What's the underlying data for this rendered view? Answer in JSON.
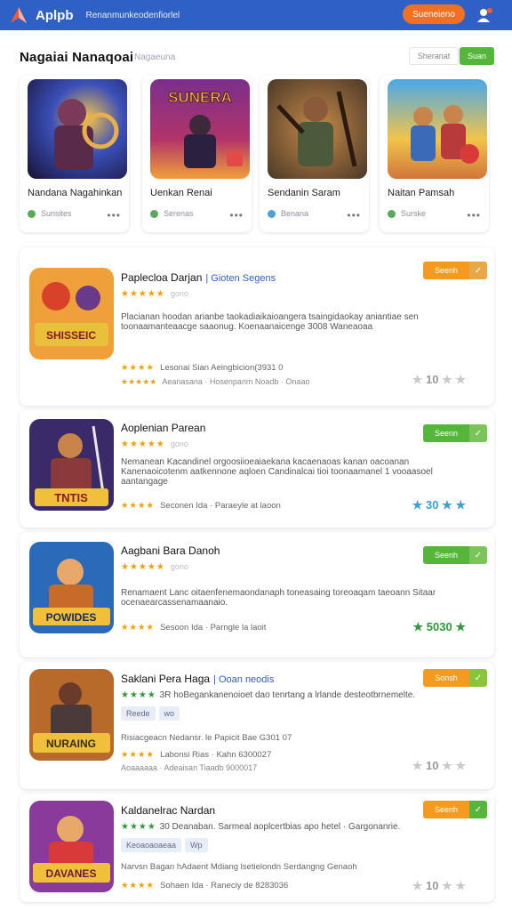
{
  "app": {
    "brand": "Aplpb",
    "tagline": "Renanmunkeodenfiorlel",
    "top_button": "Sueneieno"
  },
  "section": {
    "title": "Nagaiai Nanaqoai",
    "subtitle": "Nagaeuna",
    "search_placeholder": "Sheranat",
    "button": "Suan"
  },
  "featured": [
    {
      "name": "Nandana Nagahinkan",
      "status": "Sunsites",
      "art_text": "",
      "dot_color": "#5aa85a"
    },
    {
      "name": "Uenkan Renai",
      "status": "Serenas",
      "art_text": "SUNERA",
      "dot_color": "#5aa85a"
    },
    {
      "name": "Sendanin Saram",
      "status": "Benana",
      "art_text": "",
      "dot_color": "#4aa2d8"
    },
    {
      "name": "Naitan Pamsah",
      "status": "Surske",
      "art_text": "",
      "dot_color": "#5aa85a"
    }
  ],
  "items": [
    {
      "title": "Paplecloa Darjan",
      "subtitle": "| Gioten Segens",
      "rating_label": "gono",
      "desc": "Placianan hoodan arianbe taokadiaikaioangera tsaingidaokay aniantiae sen toonaamanteaacge saaonug. Koenaanaicenge 3008 Waneaoaa",
      "meta1": "Lesonai Sian Aeingbicion(3931 0",
      "meta2": "Aeanasana · Hosenpanm Noadb · Onaao",
      "score": "10",
      "action": "Seenh",
      "action_color": "#f39a1f",
      "thumb_text": "SHISSEIC"
    },
    {
      "title": "Aoplenian Parean",
      "subtitle": "",
      "rating_label": "gono",
      "desc": "Nemanean Kacandinel orgoosiioeaiaekana kacaenaoas kanan oacoanan Kanenaoicotenm aatkennone aqloen Candinalcai tioi toonaamanel 1 vooaasoel aantangage",
      "meta1": "Seconen Ida · Paraeyle at laoon",
      "meta2": "",
      "score": "30",
      "action": "Seenn",
      "action_color": "#56b53b",
      "thumb_text": "TNTIS"
    },
    {
      "title": "Aagbani Bara Danoh",
      "subtitle": "",
      "rating_label": "gono",
      "desc": "Renamaent Lanc oitaenfenemaondanaph toneasaing toreoaqam taeoann Sitaar ocenaearcassenamaanaio.",
      "meta1": "Sesoon Ida · Parngle la laoit",
      "meta2": "",
      "score": "5030",
      "action": "Seenh",
      "action_color": "#56b53b",
      "thumb_text": "POWIDES"
    },
    {
      "title": "Saklani Pera Haga",
      "subtitle": "| Ooan neodis",
      "rating_label": "",
      "desc": "3R hoBegankanenoioet dao tenrtang a lrlande desteotbrnemelte.",
      "tags": [
        "Reede",
        "wo"
      ],
      "meta1": "Risiacgeacn Nedansr. le Papicit Bae G301 07",
      "meta2": "Labonsi Rias · Kahn 6300027",
      "meta3": "Aoaaaaaa · Adeaisan Tiaadb 9000017",
      "score": "10",
      "action": "Sonsh",
      "action_color": "#f39a1f",
      "thumb_text": "NURAING"
    },
    {
      "title": "Kaldanelrac Nardan",
      "subtitle": "",
      "rating_label": "",
      "desc": "30 Deanaban. Sarmeal aoplcertbias apo hetel · Gargonanrie.",
      "tags": [
        "Keoaoaoaeaa",
        "Wp"
      ],
      "meta1": "Narvsn Bagan hAdaent Mdiang lsetielondn Serdangng Genaoh",
      "meta2": "Sohaen Ida · Raneciy de 8283036",
      "score": "10",
      "action": "Seenh",
      "action_color": "#f39a1f",
      "thumb_text": "DAVANES"
    }
  ]
}
